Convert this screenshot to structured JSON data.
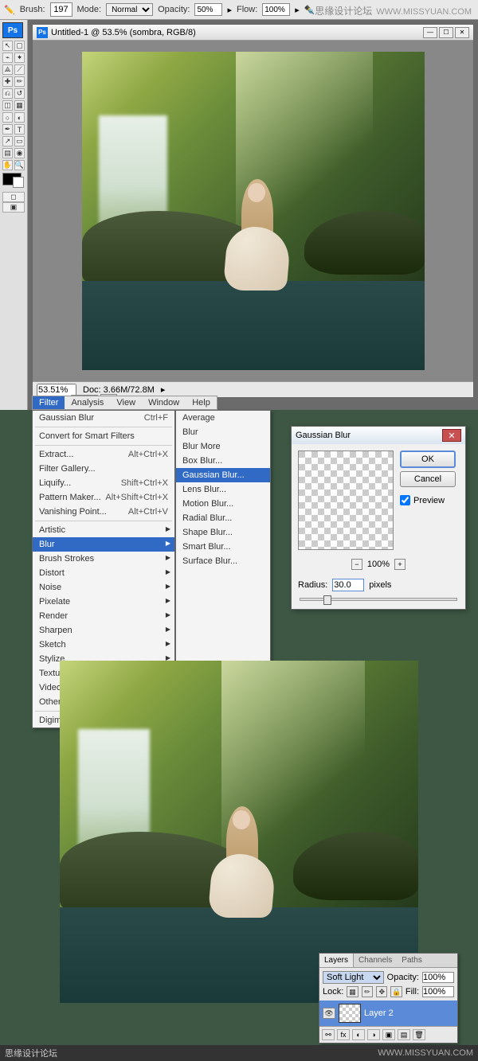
{
  "watermark": {
    "cn": "思缘设计论坛",
    "url": "WWW.MISSYUAN.COM"
  },
  "topbar": {
    "brushLabel": "Brush:",
    "brushSize": "197",
    "modeLabel": "Mode:",
    "mode": "Normal",
    "opacityLabel": "Opacity:",
    "opacity": "50%",
    "flowLabel": "Flow:",
    "flow": "100%"
  },
  "doc": {
    "title": "Untitled-1 @ 53.5% (sombra, RGB/8)",
    "zoom": "53.51%",
    "docInfo": "Doc: 3.66M/72.8M",
    "tab": "ner..."
  },
  "menubar": [
    "Filter",
    "Analysis",
    "View",
    "Window",
    "Help"
  ],
  "filterMenu": {
    "last": {
      "label": "Gaussian Blur",
      "sc": "Ctrl+F"
    },
    "convert": "Convert for Smart Filters",
    "items1": [
      {
        "label": "Extract...",
        "sc": "Alt+Ctrl+X"
      },
      {
        "label": "Filter Gallery...",
        "sc": ""
      },
      {
        "label": "Liquify...",
        "sc": "Shift+Ctrl+X"
      },
      {
        "label": "Pattern Maker...",
        "sc": "Alt+Shift+Ctrl+X"
      },
      {
        "label": "Vanishing Point...",
        "sc": "Alt+Ctrl+V"
      }
    ],
    "cats": [
      "Artistic",
      "Blur",
      "Brush Strokes",
      "Distort",
      "Noise",
      "Pixelate",
      "Render",
      "Sharpen",
      "Sketch",
      "Stylize",
      "Texture",
      "Video",
      "Other"
    ],
    "digi": "Digimarc"
  },
  "blurSub": [
    "Average",
    "Blur",
    "Blur More",
    "Box Blur...",
    "Gaussian Blur...",
    "Lens Blur...",
    "Motion Blur...",
    "Radial Blur...",
    "Shape Blur...",
    "Smart Blur...",
    "Surface Blur..."
  ],
  "dialog": {
    "title": "Gaussian Blur",
    "ok": "OK",
    "cancel": "Cancel",
    "preview": "Preview",
    "zoom": "100%",
    "radiusLabel": "Radius:",
    "radius": "30.0",
    "radiusUnit": "pixels"
  },
  "layers": {
    "tabs": [
      "Layers",
      "Channels",
      "Paths"
    ],
    "blend": "Soft Light",
    "opacityLabel": "Opacity:",
    "opacity": "100%",
    "lockLabel": "Lock:",
    "fillLabel": "Fill:",
    "fill": "100%",
    "layerName": "Layer 2"
  },
  "footer": {
    "cn": "思缘设计论坛",
    "url": "WWW.MISSYUAN.COM"
  }
}
